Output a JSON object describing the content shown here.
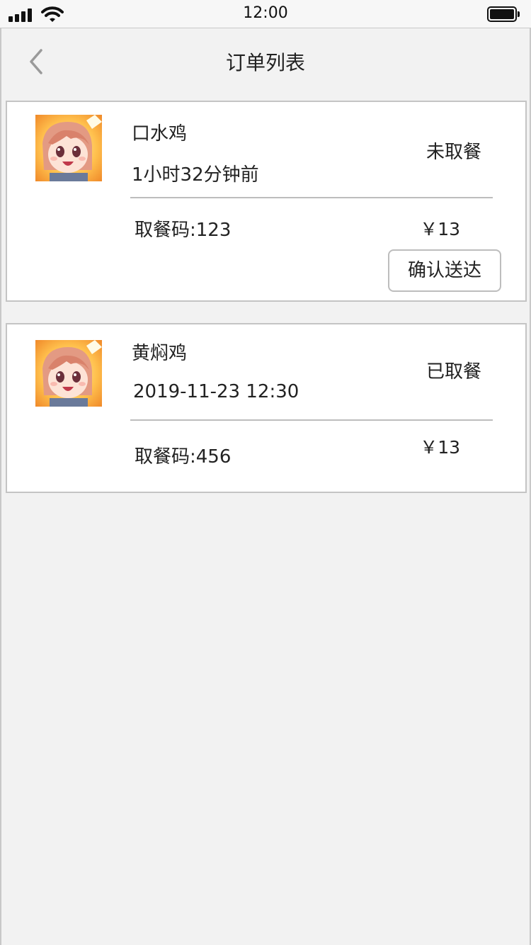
{
  "status_bar": {
    "time": "12:00",
    "icons": [
      "signal-icon",
      "wifi-icon",
      "battery-icon"
    ]
  },
  "nav": {
    "back_icon": "chevron-left-icon",
    "title": "订单列表"
  },
  "orders": [
    {
      "avatar_icon": "anime-avatar",
      "name": "口水鸡",
      "time": "1小时32分钟前",
      "status": "未取餐",
      "pickup_code": "取餐码:123",
      "price": "￥13",
      "action_label": "确认送达"
    },
    {
      "avatar_icon": "anime-avatar",
      "name": "黄焖鸡",
      "time": "2019-11-23 12:30",
      "status": "已取餐",
      "pickup_code": "取餐码:456",
      "price": "￥13"
    }
  ],
  "colors": {
    "background": "#f2f2f2",
    "card": "#ffffff",
    "border": "#c4c4c4",
    "text": "#222222",
    "back_icon": "#9a9a9a"
  }
}
